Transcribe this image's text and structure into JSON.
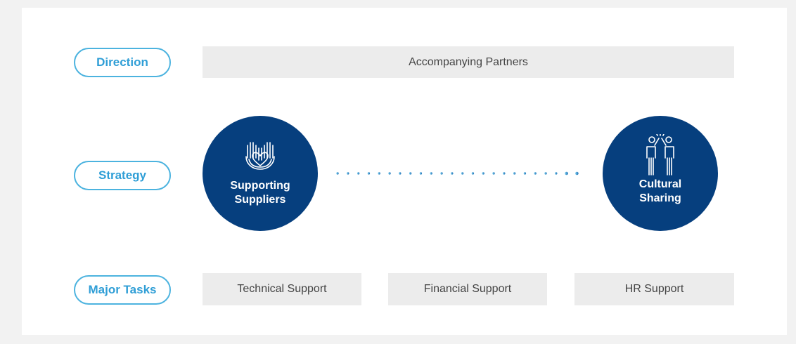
{
  "direction": {
    "label": "Direction",
    "value": "Accompanying Partners"
  },
  "strategy": {
    "label": "Strategy",
    "left": {
      "label": "Supporting\nSuppliers",
      "icon": "hands-heart-icon"
    },
    "right": {
      "label": "Cultural\nSharing",
      "icon": "people-high-five-icon"
    }
  },
  "major_tasks": {
    "label": "Major Tasks",
    "items": [
      "Technical Support",
      "Financial Support",
      "HR Support"
    ]
  },
  "colors": {
    "navy": "#063f7e",
    "sky": "#4cb3df",
    "box_gray": "#ececec"
  }
}
